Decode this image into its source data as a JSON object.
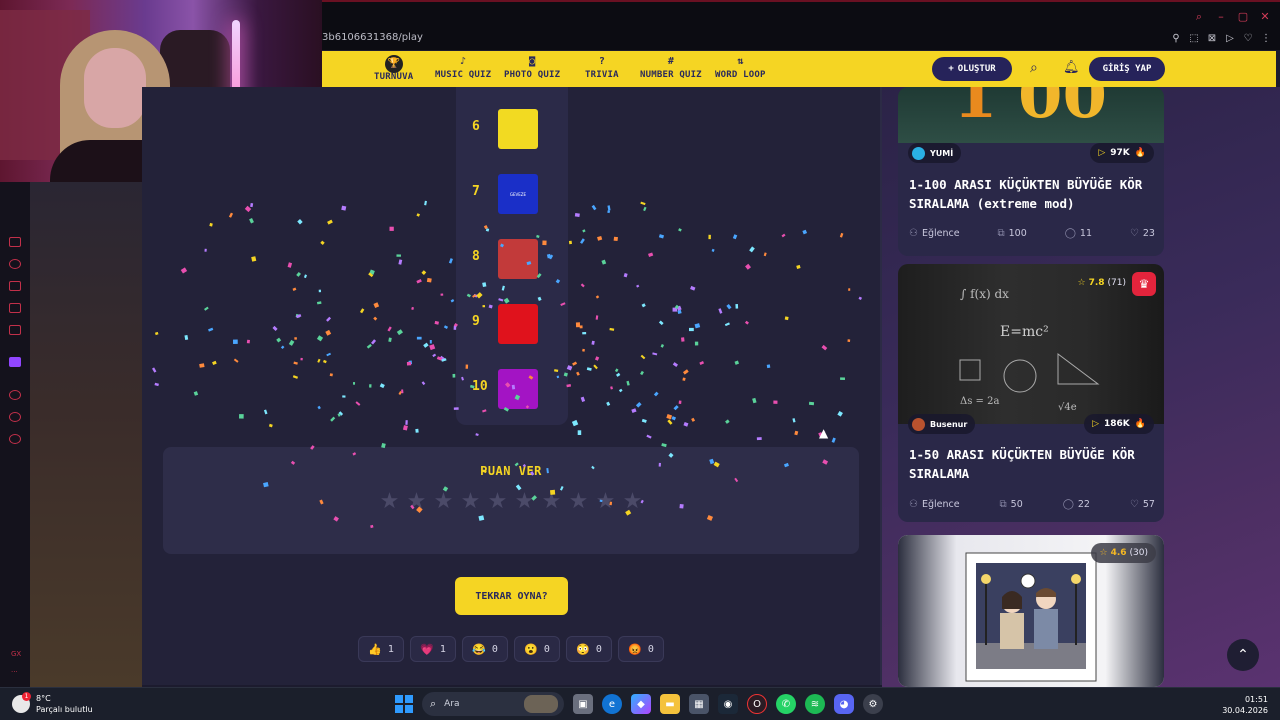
{
  "browser": {
    "url_fragment": "3b6106631368/play"
  },
  "nav": {
    "items": [
      {
        "label": "TURNUVA",
        "icon": "trophy-icon",
        "glyph": "🏆"
      },
      {
        "label": "MUSIC QUIZ",
        "icon": "music-note-icon",
        "glyph": "♪"
      },
      {
        "label": "PHOTO QUIZ",
        "icon": "camera-icon",
        "glyph": "◙"
      },
      {
        "label": "TRIVIA",
        "icon": "question-icon",
        "glyph": "?"
      },
      {
        "label": "NUMBER QUIZ",
        "icon": "hash-icon",
        "glyph": "#"
      },
      {
        "label": "WORD LOOP",
        "icon": "sort-icon",
        "glyph": "⇅"
      }
    ],
    "create_label": "OLUŞTUR",
    "login_label": "GİRİŞ YAP"
  },
  "ranking": [
    {
      "rank": "6",
      "color": "#f2da22",
      "tile_text": ""
    },
    {
      "rank": "7",
      "color": "#1a2fc8",
      "tile_text": "GEVEZE"
    },
    {
      "rank": "8",
      "color": "#c23a3a",
      "tile_text": ""
    },
    {
      "rank": "9",
      "color": "#e0121c",
      "tile_text": ""
    },
    {
      "rank": "10",
      "color": "#a314c4",
      "tile_text": ""
    }
  ],
  "rating": {
    "title": "PUAN VER",
    "star_count": 10
  },
  "replay_label": "TEKRAR OYNA?",
  "reactions": [
    {
      "emoji": "👍",
      "count": "1"
    },
    {
      "emoji": "💗",
      "count": "1"
    },
    {
      "emoji": "😂",
      "count": "0"
    },
    {
      "emoji": "😮",
      "count": "0"
    },
    {
      "emoji": "😳",
      "count": "0"
    },
    {
      "emoji": "😡",
      "count": "0"
    }
  ],
  "cards": [
    {
      "user": "YUMİ",
      "plays": "97K",
      "title": "1-100 ARASI KÜÇÜKTEN BÜYÜĞE KÖR SIRALAMA (extreme mod)",
      "category": "Eğlence",
      "items": "100",
      "comments": "11",
      "likes": "23"
    },
    {
      "user": "Busenur",
      "plays": "186K",
      "rating": "7.8",
      "rating_count": "(71)",
      "title": "1-50 ARASI KÜÇÜKTEN BÜYÜĞE KÖR SIRALAMA",
      "category": "Eğlence",
      "items": "50",
      "comments": "22",
      "likes": "57"
    },
    {
      "rating": "4.6",
      "rating_count": "(30)"
    }
  ],
  "taskbar": {
    "temp": "8°C",
    "weather": "Parçalı bulutlu",
    "search": "Ara",
    "time": "01:51",
    "date": "30.04.2026"
  },
  "colors": {
    "accent_yellow": "#f5d523",
    "nav_button_navy": "#26235a",
    "main_bg": "#232239"
  }
}
